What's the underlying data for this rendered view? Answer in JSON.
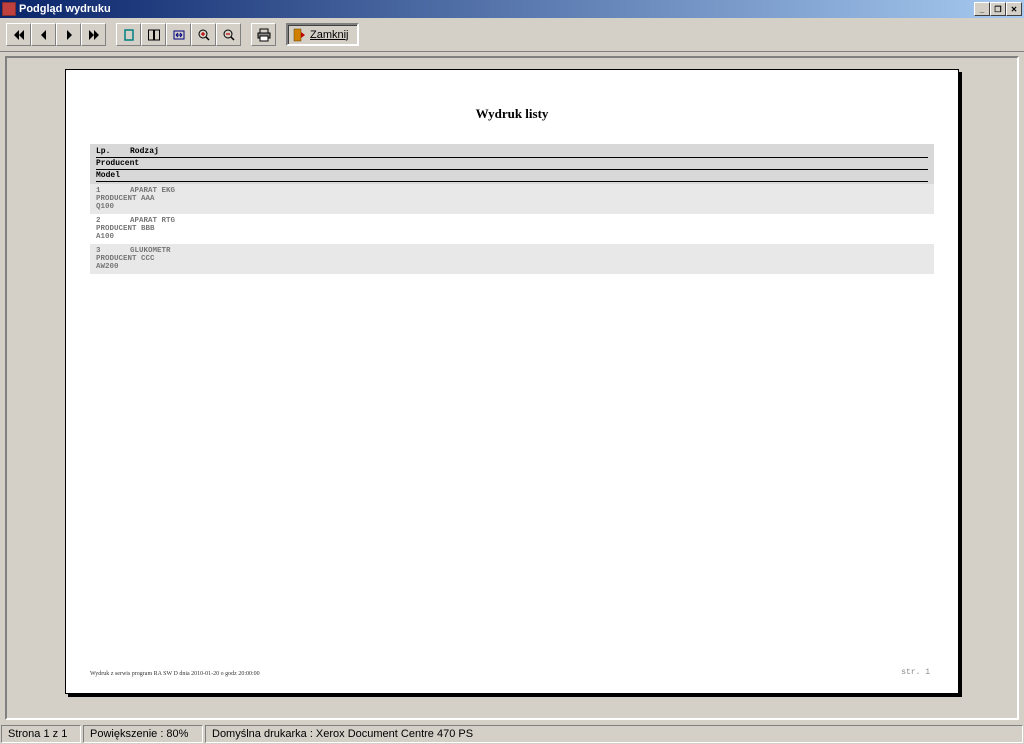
{
  "window": {
    "title": "Podgląd wydruku"
  },
  "toolbar": {
    "close_label": "Zamknij"
  },
  "report": {
    "title": "Wydruk listy",
    "headers": {
      "lp": "Lp.",
      "rodzaj": "Rodzaj",
      "producent": "Producent",
      "model": "Model"
    },
    "rows": [
      {
        "lp": "1",
        "rodzaj": "APARAT EKG",
        "producent": "PRODUCENT AAA",
        "model": "Q100"
      },
      {
        "lp": "2",
        "rodzaj": "APARAT RTG",
        "producent": "PRODUCENT BBB",
        "model": "A100"
      },
      {
        "lp": "3",
        "rodzaj": "GLUKOMETR",
        "producent": "PRODUCENT CCC",
        "model": "AW200"
      }
    ],
    "footer_left": "Wydruk z serwis program RA SW D dnia 2010-01-20 o godz 20:00:00",
    "footer_right": "str. 1"
  },
  "status": {
    "page": "Strona 1 z 1",
    "zoom": "Powiększenie : 80%",
    "printer": "Domyślna drukarka : Xerox Document Centre 470 PS"
  }
}
